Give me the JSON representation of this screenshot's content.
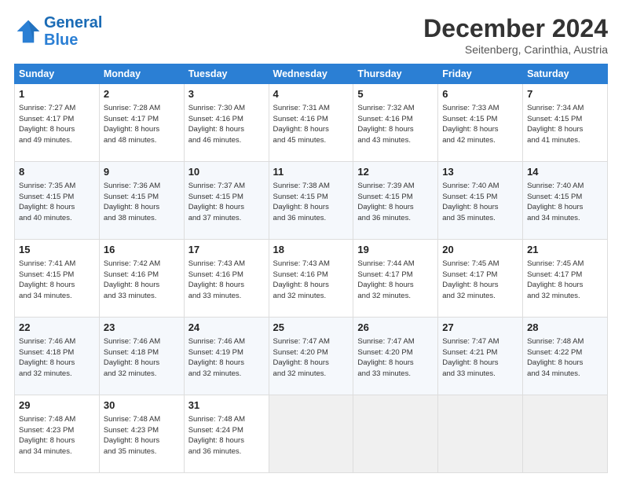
{
  "header": {
    "logo_line1": "General",
    "logo_line2": "Blue",
    "month": "December 2024",
    "location": "Seitenberg, Carinthia, Austria"
  },
  "days_of_week": [
    "Sunday",
    "Monday",
    "Tuesday",
    "Wednesday",
    "Thursday",
    "Friday",
    "Saturday"
  ],
  "weeks": [
    [
      {
        "day": "1",
        "lines": [
          "Sunrise: 7:27 AM",
          "Sunset: 4:17 PM",
          "Daylight: 8 hours",
          "and 49 minutes."
        ]
      },
      {
        "day": "2",
        "lines": [
          "Sunrise: 7:28 AM",
          "Sunset: 4:17 PM",
          "Daylight: 8 hours",
          "and 48 minutes."
        ]
      },
      {
        "day": "3",
        "lines": [
          "Sunrise: 7:30 AM",
          "Sunset: 4:16 PM",
          "Daylight: 8 hours",
          "and 46 minutes."
        ]
      },
      {
        "day": "4",
        "lines": [
          "Sunrise: 7:31 AM",
          "Sunset: 4:16 PM",
          "Daylight: 8 hours",
          "and 45 minutes."
        ]
      },
      {
        "day": "5",
        "lines": [
          "Sunrise: 7:32 AM",
          "Sunset: 4:16 PM",
          "Daylight: 8 hours",
          "and 43 minutes."
        ]
      },
      {
        "day": "6",
        "lines": [
          "Sunrise: 7:33 AM",
          "Sunset: 4:15 PM",
          "Daylight: 8 hours",
          "and 42 minutes."
        ]
      },
      {
        "day": "7",
        "lines": [
          "Sunrise: 7:34 AM",
          "Sunset: 4:15 PM",
          "Daylight: 8 hours",
          "and 41 minutes."
        ]
      }
    ],
    [
      {
        "day": "8",
        "lines": [
          "Sunrise: 7:35 AM",
          "Sunset: 4:15 PM",
          "Daylight: 8 hours",
          "and 40 minutes."
        ]
      },
      {
        "day": "9",
        "lines": [
          "Sunrise: 7:36 AM",
          "Sunset: 4:15 PM",
          "Daylight: 8 hours",
          "and 38 minutes."
        ]
      },
      {
        "day": "10",
        "lines": [
          "Sunrise: 7:37 AM",
          "Sunset: 4:15 PM",
          "Daylight: 8 hours",
          "and 37 minutes."
        ]
      },
      {
        "day": "11",
        "lines": [
          "Sunrise: 7:38 AM",
          "Sunset: 4:15 PM",
          "Daylight: 8 hours",
          "and 36 minutes."
        ]
      },
      {
        "day": "12",
        "lines": [
          "Sunrise: 7:39 AM",
          "Sunset: 4:15 PM",
          "Daylight: 8 hours",
          "and 36 minutes."
        ]
      },
      {
        "day": "13",
        "lines": [
          "Sunrise: 7:40 AM",
          "Sunset: 4:15 PM",
          "Daylight: 8 hours",
          "and 35 minutes."
        ]
      },
      {
        "day": "14",
        "lines": [
          "Sunrise: 7:40 AM",
          "Sunset: 4:15 PM",
          "Daylight: 8 hours",
          "and 34 minutes."
        ]
      }
    ],
    [
      {
        "day": "15",
        "lines": [
          "Sunrise: 7:41 AM",
          "Sunset: 4:15 PM",
          "Daylight: 8 hours",
          "and 34 minutes."
        ]
      },
      {
        "day": "16",
        "lines": [
          "Sunrise: 7:42 AM",
          "Sunset: 4:16 PM",
          "Daylight: 8 hours",
          "and 33 minutes."
        ]
      },
      {
        "day": "17",
        "lines": [
          "Sunrise: 7:43 AM",
          "Sunset: 4:16 PM",
          "Daylight: 8 hours",
          "and 33 minutes."
        ]
      },
      {
        "day": "18",
        "lines": [
          "Sunrise: 7:43 AM",
          "Sunset: 4:16 PM",
          "Daylight: 8 hours",
          "and 32 minutes."
        ]
      },
      {
        "day": "19",
        "lines": [
          "Sunrise: 7:44 AM",
          "Sunset: 4:17 PM",
          "Daylight: 8 hours",
          "and 32 minutes."
        ]
      },
      {
        "day": "20",
        "lines": [
          "Sunrise: 7:45 AM",
          "Sunset: 4:17 PM",
          "Daylight: 8 hours",
          "and 32 minutes."
        ]
      },
      {
        "day": "21",
        "lines": [
          "Sunrise: 7:45 AM",
          "Sunset: 4:17 PM",
          "Daylight: 8 hours",
          "and 32 minutes."
        ]
      }
    ],
    [
      {
        "day": "22",
        "lines": [
          "Sunrise: 7:46 AM",
          "Sunset: 4:18 PM",
          "Daylight: 8 hours",
          "and 32 minutes."
        ]
      },
      {
        "day": "23",
        "lines": [
          "Sunrise: 7:46 AM",
          "Sunset: 4:18 PM",
          "Daylight: 8 hours",
          "and 32 minutes."
        ]
      },
      {
        "day": "24",
        "lines": [
          "Sunrise: 7:46 AM",
          "Sunset: 4:19 PM",
          "Daylight: 8 hours",
          "and 32 minutes."
        ]
      },
      {
        "day": "25",
        "lines": [
          "Sunrise: 7:47 AM",
          "Sunset: 4:20 PM",
          "Daylight: 8 hours",
          "and 32 minutes."
        ]
      },
      {
        "day": "26",
        "lines": [
          "Sunrise: 7:47 AM",
          "Sunset: 4:20 PM",
          "Daylight: 8 hours",
          "and 33 minutes."
        ]
      },
      {
        "day": "27",
        "lines": [
          "Sunrise: 7:47 AM",
          "Sunset: 4:21 PM",
          "Daylight: 8 hours",
          "and 33 minutes."
        ]
      },
      {
        "day": "28",
        "lines": [
          "Sunrise: 7:48 AM",
          "Sunset: 4:22 PM",
          "Daylight: 8 hours",
          "and 34 minutes."
        ]
      }
    ],
    [
      {
        "day": "29",
        "lines": [
          "Sunrise: 7:48 AM",
          "Sunset: 4:23 PM",
          "Daylight: 8 hours",
          "and 34 minutes."
        ]
      },
      {
        "day": "30",
        "lines": [
          "Sunrise: 7:48 AM",
          "Sunset: 4:23 PM",
          "Daylight: 8 hours",
          "and 35 minutes."
        ]
      },
      {
        "day": "31",
        "lines": [
          "Sunrise: 7:48 AM",
          "Sunset: 4:24 PM",
          "Daylight: 8 hours",
          "and 36 minutes."
        ]
      },
      null,
      null,
      null,
      null
    ]
  ]
}
